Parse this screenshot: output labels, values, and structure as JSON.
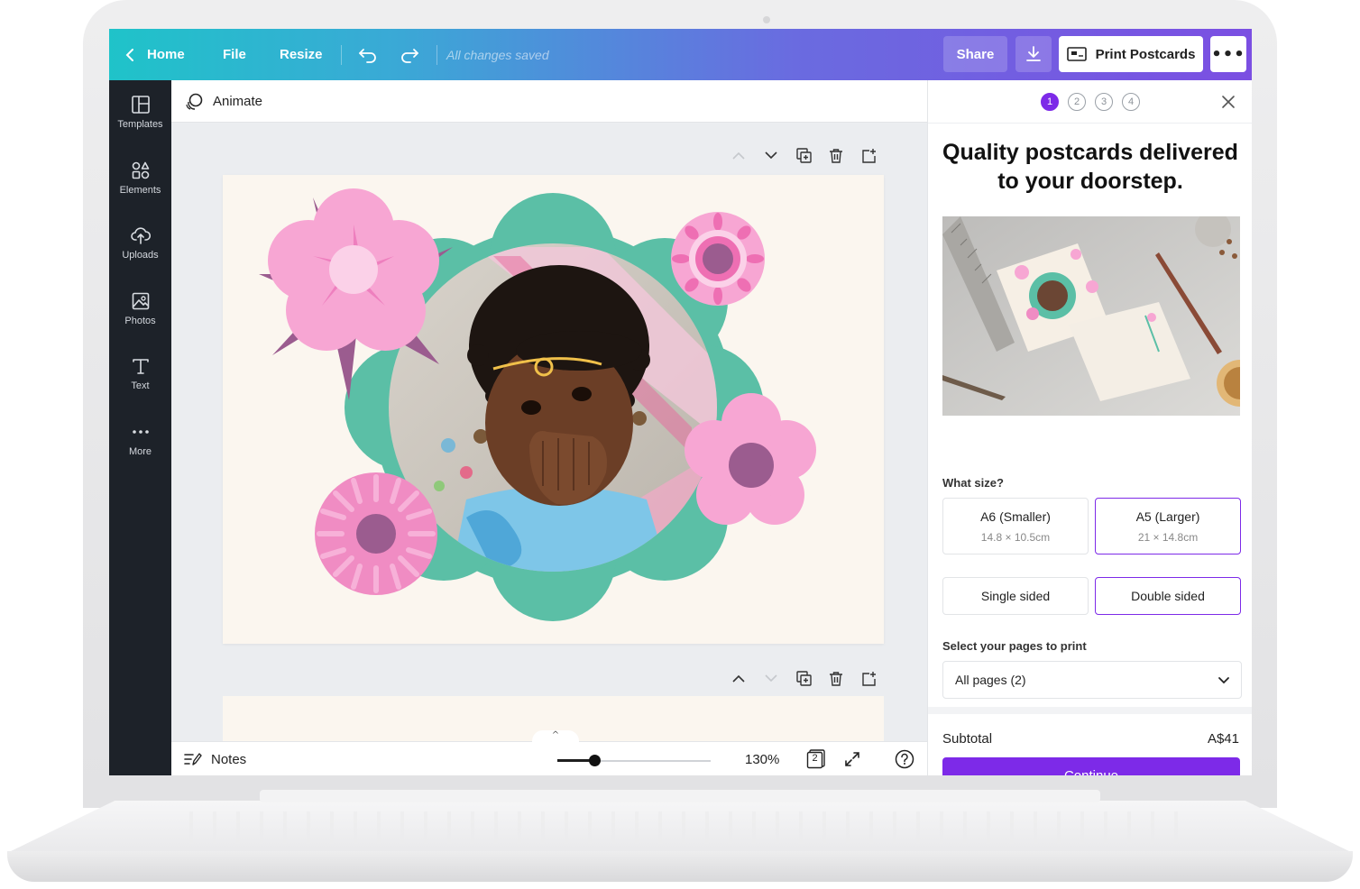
{
  "topbar": {
    "home_label": "Home",
    "file_label": "File",
    "resize_label": "Resize",
    "saved_status": "All changes saved",
    "share_label": "Share",
    "print_label": "Print Postcards"
  },
  "sidebar": {
    "items": [
      {
        "label": "Templates",
        "icon": "templates-icon"
      },
      {
        "label": "Elements",
        "icon": "elements-icon"
      },
      {
        "label": "Uploads",
        "icon": "uploads-icon"
      },
      {
        "label": "Photos",
        "icon": "photos-icon"
      },
      {
        "label": "Text",
        "icon": "text-icon"
      },
      {
        "label": "More",
        "icon": "more-icon"
      }
    ]
  },
  "context_bar": {
    "animate_label": "Animate"
  },
  "footer": {
    "notes_label": "Notes",
    "zoom_value": "130%",
    "zoom_level": 0.24,
    "page_count": "2"
  },
  "panel": {
    "steps": [
      "1",
      "2",
      "3",
      "4"
    ],
    "active_step": 1,
    "title_line1": "Quality postcards delivered",
    "title_line2": "to your doorstep.",
    "size_label": "What size?",
    "sizes": [
      {
        "name": "A6 (Smaller)",
        "dims": "14.8 × 10.5cm",
        "selected": false
      },
      {
        "name": "A5 (Larger)",
        "dims": "21 × 14.8cm",
        "selected": true
      }
    ],
    "sides": [
      {
        "name": "Single sided",
        "selected": false
      },
      {
        "name": "Double sided",
        "selected": true
      }
    ],
    "pages_label": "Select your pages to print",
    "pages_value": "All pages (2)",
    "subtotal_label": "Subtotal",
    "subtotal_value": "A$41",
    "continue_label": "Continue"
  },
  "colors": {
    "accent": "#7d2ae8",
    "topbar_start": "#1fc3c9",
    "topbar_end": "#7b4fe2",
    "sidebar_bg": "#1d2229",
    "teal_frame": "#5bbfa6",
    "flower_pink": "#f7a6d3",
    "flower_center": "#9b5c8f"
  }
}
